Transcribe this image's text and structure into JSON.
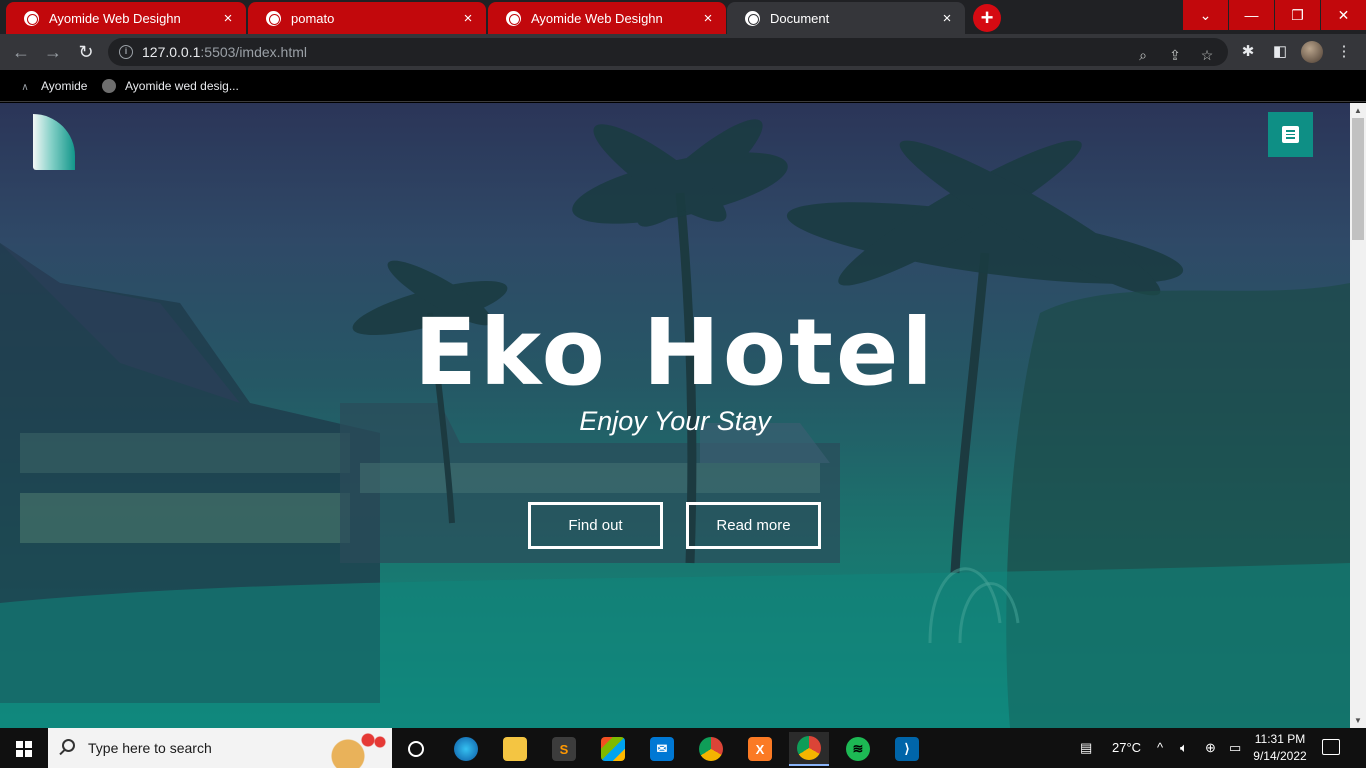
{
  "browser": {
    "tabs": [
      {
        "title": "Ayomide Web Desighn",
        "close": "×",
        "state": "red"
      },
      {
        "title": "pomato",
        "close": "×",
        "state": "red"
      },
      {
        "title": "Ayomide Web Desighn",
        "close": "×",
        "state": "red"
      },
      {
        "title": "Document",
        "close": "×",
        "state": "active"
      }
    ],
    "new_tab": "+",
    "window_controls": {
      "tab_search": "⌄",
      "minimize": "—",
      "restore": "❐",
      "close": "✕"
    },
    "address": {
      "host": "127.0.0.1",
      "path": ":5503/imdex.html"
    },
    "bookmarks": [
      {
        "label": "Ayomide",
        "icon": "caret-icon"
      },
      {
        "label": "Ayomide wed desig...",
        "icon": "globe-icon"
      }
    ]
  },
  "page": {
    "hero_title": "Eko Hotel",
    "hero_subtitle": "Enjoy Your Stay",
    "buttons": {
      "find_out": "Find out",
      "read_more": "Read more"
    },
    "accent_color": "#0e8f85"
  },
  "taskbar": {
    "search_placeholder": "Type here to search",
    "weather": "27°C",
    "time": "11:31 PM",
    "date": "9/14/2022"
  }
}
